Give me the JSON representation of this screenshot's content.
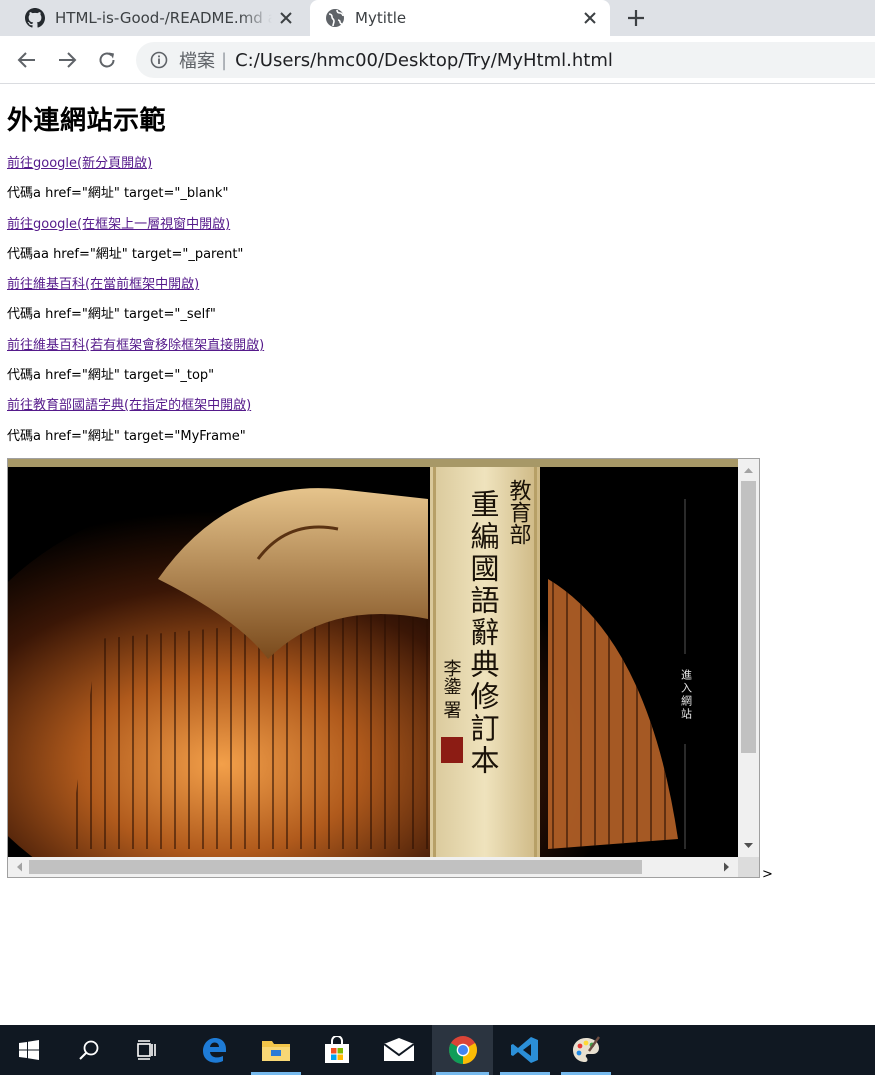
{
  "browser": {
    "tabs": [
      {
        "title": "HTML-is-Good-/README.md at",
        "icon": "github-icon",
        "active": false
      },
      {
        "title": "Mytitle",
        "icon": "globe-icon",
        "active": true
      }
    ],
    "new_tab_icon": "plus-icon",
    "nav": {
      "back_icon": "arrow-left-icon",
      "forward_icon": "arrow-right-icon",
      "reload_icon": "reload-icon"
    },
    "address_bar": {
      "info_icon": "info-icon",
      "scheme_label": "檔案",
      "separator": "|",
      "url": "C:/Users/hmc00/Desktop/Try/MyHtml.html"
    }
  },
  "page": {
    "heading": "外連網站示範",
    "entries": [
      {
        "link": "前往google(新分頁開啟)",
        "code": "代碼a href=\"網址\" target=\"_blank\""
      },
      {
        "link": "前往google(在框架上一層視窗中開啟)",
        "code": "代碼aa href=\"網址\" target=\"_parent\""
      },
      {
        "link": "前往維基百科(在當前框架中開啟)",
        "code": "代碼a href=\"網址\" target=\"_self\""
      },
      {
        "link": "前往維基百科(若有框架會移除框架直接開啟)",
        "code": "代碼a href=\"網址\" target=\"_top\""
      },
      {
        "link": "前往教育部國語字典(在指定的框架中開啟)",
        "code": "代碼a href=\"網址\" target=\"MyFrame\""
      }
    ],
    "iframe": {
      "banner_text": {
        "ministry": "教育部",
        "dictionary_title": "重編國語辭典修訂本",
        "calligrapher": "李鍌 署",
        "enter_site": "進入網站"
      }
    },
    "trailing_text": ">"
  },
  "taskbar": {
    "items": [
      {
        "icon": "windows-start-icon",
        "active": false,
        "running": false
      },
      {
        "icon": "search-icon",
        "active": false,
        "running": false
      },
      {
        "icon": "task-view-icon",
        "active": false,
        "running": false
      },
      {
        "icon": "edge-icon",
        "active": false,
        "running": false
      },
      {
        "icon": "file-explorer-icon",
        "active": false,
        "running": true
      },
      {
        "icon": "store-icon",
        "active": false,
        "running": false
      },
      {
        "icon": "mail-icon",
        "active": false,
        "running": false
      },
      {
        "icon": "chrome-icon",
        "active": true,
        "running": true
      },
      {
        "icon": "vscode-icon",
        "active": false,
        "running": true
      },
      {
        "icon": "paint-icon",
        "active": false,
        "running": true
      }
    ]
  },
  "colors": {
    "link_visited": "#551a8b",
    "tabstrip_bg": "#dee1e6",
    "omnibox_bg": "#f1f3f4",
    "taskbar_bg": "#101822",
    "taskbar_indicator": "#76b9ed"
  }
}
